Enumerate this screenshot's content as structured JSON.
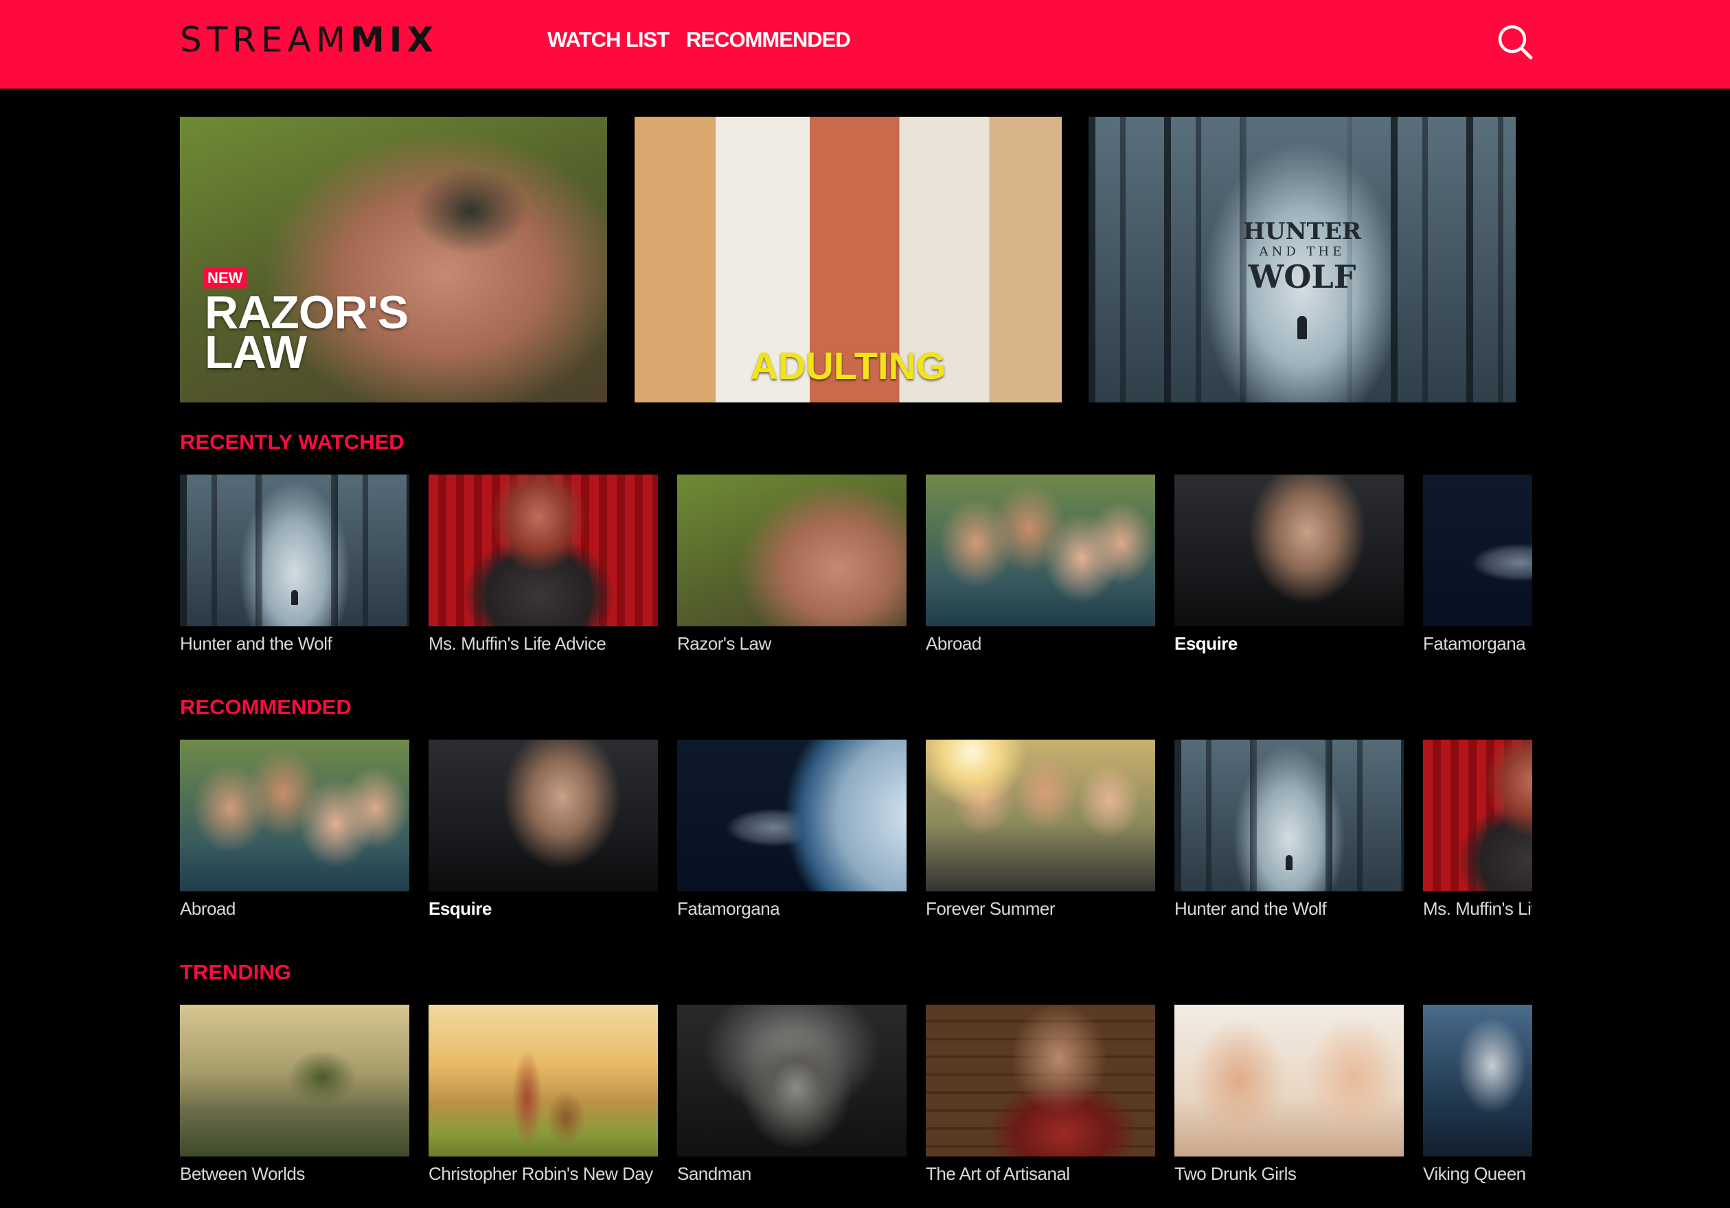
{
  "header": {
    "logo_light": "STREAM",
    "logo_bold": "MIX",
    "nav": [
      {
        "label": "WATCH LIST"
      },
      {
        "label": "RECOMMENDED"
      }
    ],
    "search_icon": "search-icon",
    "background": "#ff0a3e"
  },
  "hero": [
    {
      "badge": "NEW",
      "title": "RAZOR'S LAW"
    },
    {
      "title": "ADULTING"
    },
    {
      "title_line1": "HUNTER",
      "title_line2": "AND THE",
      "title_line3": "WOLF"
    }
  ],
  "sections": [
    {
      "title": "RECENTLY WATCHED",
      "items": [
        {
          "title": "Hunter and the Wolf"
        },
        {
          "title": "Ms. Muffin's Life Advice"
        },
        {
          "title": "Razor's Law"
        },
        {
          "title": "Abroad"
        },
        {
          "title": "Esquire",
          "active": true
        },
        {
          "title": "Fatamorgana"
        }
      ]
    },
    {
      "title": "RECOMMENDED",
      "items": [
        {
          "title": "Abroad"
        },
        {
          "title": "Esquire",
          "active": true
        },
        {
          "title": "Fatamorgana"
        },
        {
          "title": "Forever Summer"
        },
        {
          "title": "Hunter and the Wolf"
        },
        {
          "title": "Ms. Muffin's Life"
        }
      ]
    },
    {
      "title": "TRENDING",
      "items": [
        {
          "title": "Between Worlds"
        },
        {
          "title": "Christopher Robin's New Day"
        },
        {
          "title": "Sandman"
        },
        {
          "title": "The Art of Artisanal"
        },
        {
          "title": "Two Drunk Girls"
        },
        {
          "title": "Viking Queen"
        }
      ]
    }
  ],
  "colors": {
    "accent": "#ff0a3e",
    "background": "#000000",
    "hero_title_yellow": "#f2e418"
  }
}
